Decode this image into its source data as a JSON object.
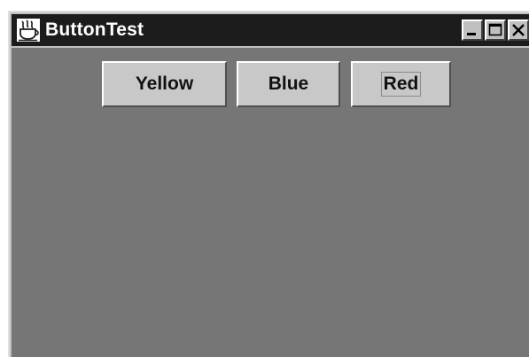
{
  "window": {
    "title": "ButtonTest",
    "app_icon": "java-coffee-cup-icon",
    "controls": [
      "minimize-icon",
      "maximize-icon",
      "close-icon"
    ]
  },
  "buttons": [
    {
      "label": "Yellow"
    },
    {
      "label": "Blue"
    },
    {
      "label": "Red",
      "focused": true
    }
  ],
  "colors": {
    "title_bar": "#1c1c1c",
    "panel_background": "#767676",
    "button_face": "#c8c8c8",
    "window_frame": "#c0c0c0"
  }
}
